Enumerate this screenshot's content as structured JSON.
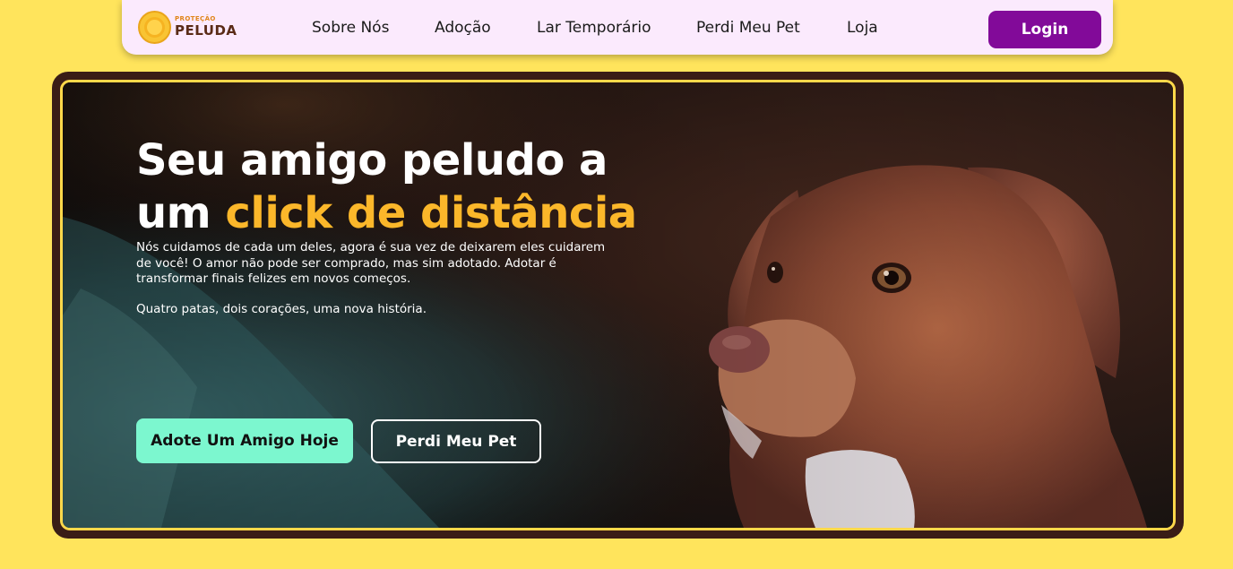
{
  "brand": {
    "name_small": "PROTEÇÃO",
    "name_big": "PELUDA",
    "icon": "paw-badge-icon"
  },
  "nav": {
    "links": [
      "Sobre Nós",
      "Adoção",
      "Lar Temporário",
      "Perdi Meu Pet",
      "Loja"
    ],
    "login_label": "Login"
  },
  "hero": {
    "title_line1": "Seu amigo peludo a",
    "title_line2_prefix": "um ",
    "title_line2_accent": "click de distância",
    "description": "Nós cuidamos de cada um deles, agora é sua vez de deixarem eles cuidarem de você! O amor não pode ser comprado, mas sim adotado. Adotar é transformar finais felizes em novos começos.",
    "tagline": "Quatro patas, dois corações, uma nova história.",
    "primary_cta": "Adote Um Amigo Hoje",
    "secondary_cta": "Perdi Meu Pet",
    "image": "brown-dog-photo"
  },
  "colors": {
    "page_background": "#ffe45c",
    "navbar_background": "#fbeafd",
    "login_button": "#820a99",
    "accent_text": "#fbb72a",
    "primary_cta": "#7cf7cf",
    "hero_frame": "#3a1d16",
    "hero_border": "#ffd84a"
  }
}
